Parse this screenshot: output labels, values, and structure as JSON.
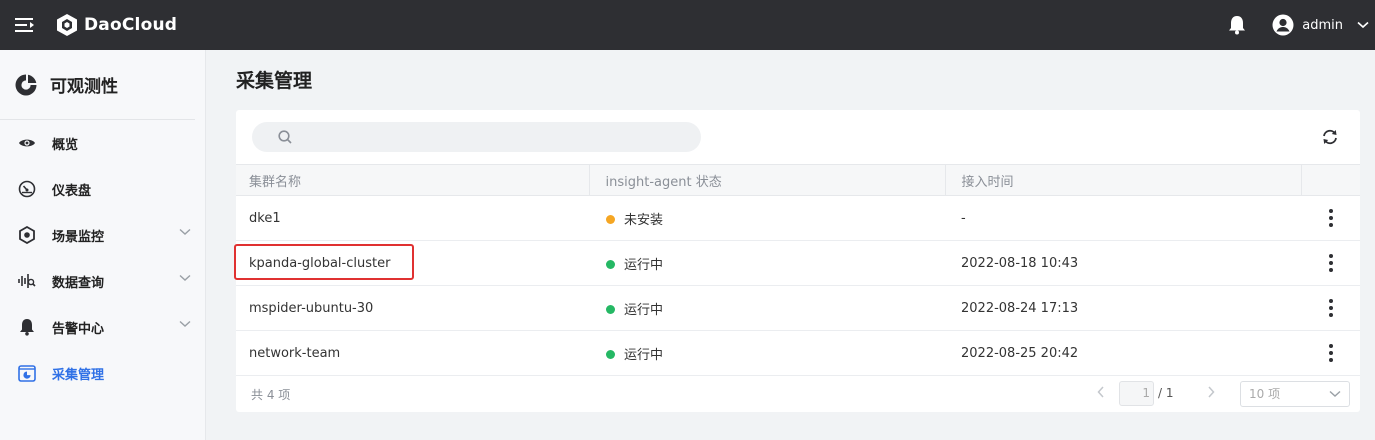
{
  "app": {
    "brand": "DaoCloud"
  },
  "header": {
    "username": "admin"
  },
  "sidebar": {
    "module_title": "可观测性",
    "items": [
      {
        "label": "概览",
        "icon": "eye-icon",
        "expandable": false,
        "active": false
      },
      {
        "label": "仪表盘",
        "icon": "gauge-icon",
        "expandable": false,
        "active": false
      },
      {
        "label": "场景监控",
        "icon": "hexagon-icon",
        "expandable": true,
        "active": false
      },
      {
        "label": "数据查询",
        "icon": "waveform-icon",
        "expandable": true,
        "active": false
      },
      {
        "label": "告警中心",
        "icon": "bell-icon",
        "expandable": true,
        "active": false
      },
      {
        "label": "采集管理",
        "icon": "collection-icon",
        "expandable": false,
        "active": true
      }
    ]
  },
  "main": {
    "page_title": "采集管理",
    "search": {
      "placeholder": "",
      "value": ""
    },
    "table": {
      "columns": [
        "集群名称",
        "insight-agent 状态",
        "接入时间",
        ""
      ],
      "rows": [
        {
          "name": "dke1",
          "status": "未安装",
          "status_color": "#f5a623",
          "time": "-"
        },
        {
          "name": "kpanda-global-cluster",
          "status": "运行中",
          "status_color": "#25b864",
          "time": "2022-08-18 10:43"
        },
        {
          "name": "mspider-ubuntu-30",
          "status": "运行中",
          "status_color": "#25b864",
          "time": "2022-08-24 17:13"
        },
        {
          "name": "network-team",
          "status": "运行中",
          "status_color": "#25b864",
          "time": "2022-08-25 20:42"
        }
      ]
    },
    "footer": {
      "total": "共 4 项",
      "current_page": "1",
      "page_total": "/ 1",
      "page_size": "10 项"
    }
  },
  "colors": {
    "accent": "#3071e6",
    "topbar": "#2e2f33",
    "highlight": "#e03131"
  }
}
